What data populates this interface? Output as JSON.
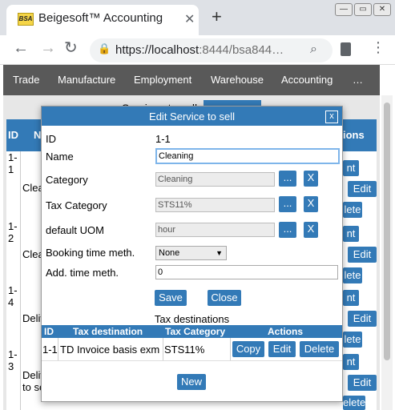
{
  "browser": {
    "tab_title": "Beigesoft™ Accounting",
    "tab_favicon": "BSA",
    "close_tab": "✕",
    "new_tab": "+",
    "url_host": "https://localhost",
    "url_rest": ":8444/bsa844…",
    "win_buttons": [
      "—",
      "▭",
      "✕"
    ]
  },
  "nav": {
    "items": [
      "Trade",
      "Manufacture",
      "Employment",
      "Warehouse",
      "Accounting",
      "…"
    ]
  },
  "background": {
    "title": "Services to sell",
    "header_id": "ID",
    "header_name": "N",
    "header_actions": "ions",
    "rows": [
      {
        "id": "1-1",
        "name": "Clea"
      },
      {
        "id": "1-2",
        "name": "Clea"
      },
      {
        "id": "1-4",
        "name": "Deliv"
      },
      {
        "id": "1-3",
        "name": "Deliv\nto se"
      }
    ],
    "btn_edit": "Edit",
    "btn_nt": "nt",
    "btn_delete": "lete",
    "btn_delete2": "elete",
    "btn_delete_last": "Delete"
  },
  "modal": {
    "title": "Edit Service to sell",
    "close": "x",
    "id_label": "ID",
    "id_value": "1-1",
    "name_label": "Name",
    "name_value": "Cleaning",
    "category_label": "Category",
    "category_value": "Cleaning",
    "tax_category_label": "Tax Category",
    "tax_category_value": "STS11%",
    "uom_label": "default UOM",
    "uom_value": "hour",
    "booking_label": "Booking time meth.",
    "booking_value": "None",
    "add_time_label": "Add. time meth.",
    "add_time_value": "0",
    "pick_button": "...",
    "clear_button": "X",
    "save_button": "Save",
    "close_button": "Close",
    "tax_dest_title": "Tax destinations",
    "table": {
      "headers": [
        "ID",
        "Tax destination",
        "Tax Category",
        "Actions"
      ],
      "rows": [
        {
          "id": "1-1",
          "destination": "TD Invoice basis exm",
          "category": "STS11%"
        }
      ],
      "copy": "Copy",
      "edit": "Edit",
      "delete": "Delete"
    },
    "new_button": "New"
  }
}
